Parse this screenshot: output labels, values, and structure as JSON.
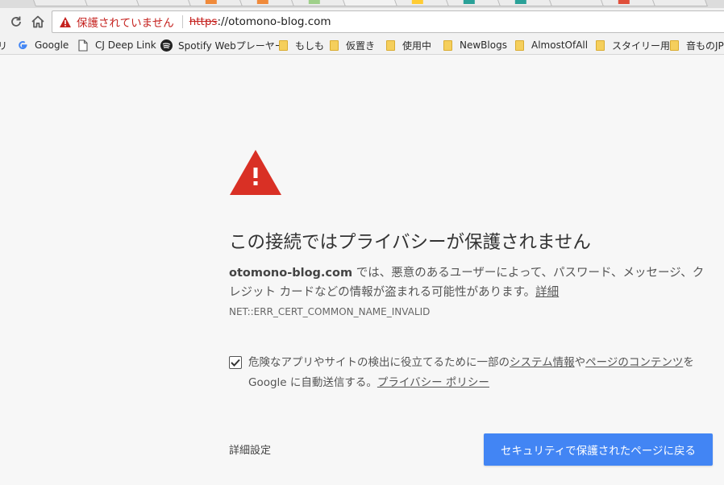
{
  "toolbar": {
    "security_label": "保護されていません",
    "url_scheme": "https",
    "url_rest": "://otomono-blog.com"
  },
  "bookmarks": [
    {
      "label": "リ",
      "icon": "partial-icon"
    },
    {
      "label": "Google",
      "icon": "google-icon"
    },
    {
      "label": "CJ Deep Link",
      "icon": "page-icon"
    },
    {
      "label": "Spotify Webプレーヤー",
      "icon": "spotify-icon"
    },
    {
      "label": "もしも",
      "icon": "folder-icon"
    },
    {
      "label": "仮置き",
      "icon": "folder-icon"
    },
    {
      "label": "使用中",
      "icon": "folder-icon"
    },
    {
      "label": "NewBlogs",
      "icon": "folder-icon"
    },
    {
      "label": "AlmostOfAll",
      "icon": "folder-icon"
    },
    {
      "label": "スタイリー用",
      "icon": "folder-icon"
    },
    {
      "label": "音ものJP",
      "icon": "folder-icon"
    }
  ],
  "interstitial": {
    "heading": "この接続ではプライバシーが保護されません",
    "domain": "otomono-blog.com",
    "desc_text": " では、悪意のあるユーザーによって、パスワード、メッセージ、クレジット カードなどの情報が盗まれる可能性があります。",
    "details_link": "詳細",
    "error_code": "NET::ERR_CERT_COMMON_NAME_INVALID",
    "optin_checked": true,
    "optin_text_1": "危険なアプリやサイトの検出に役立てるために一部の",
    "optin_link_1": "システム情報",
    "optin_text_2": "や",
    "optin_link_2": "ページのコンテンツ",
    "optin_text_3": "を Google に自動送信する。",
    "optin_link_3": "プライバシー ポリシー",
    "advanced_button": "詳細設定",
    "back_button": "セキュリティで保護されたページに戻る"
  },
  "colors": {
    "accent_blue": "#4285f4",
    "warning_red": "#d93025",
    "insecure_red": "#c5221f",
    "background": "#f7f7f7"
  }
}
